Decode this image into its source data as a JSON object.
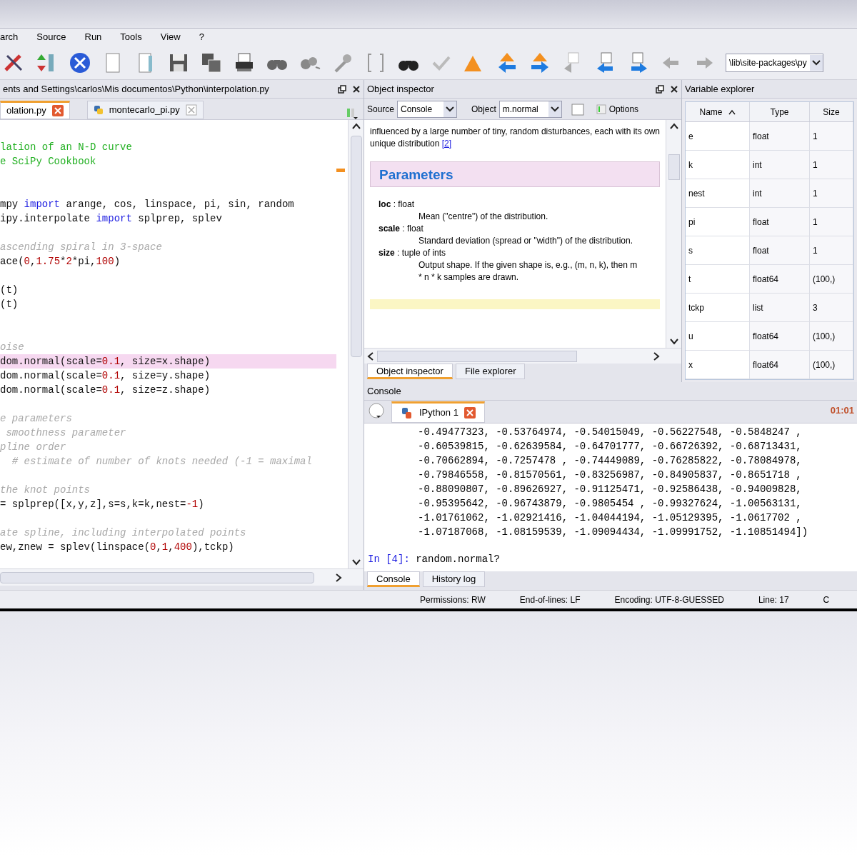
{
  "menu": [
    "arch",
    "Source",
    "Run",
    "Tools",
    "View",
    "?"
  ],
  "toolbar": {
    "path_field": "\\lib\\site-packages\\py"
  },
  "editor": {
    "title": "ents and Settings\\carlos\\Mis documentos\\Python\\interpolation.py",
    "tabs": [
      {
        "label": "olation.py",
        "selected": true
      },
      {
        "label": "montecarlo_pi.py",
        "selected": false
      }
    ],
    "lines": [
      {
        "kind": "code",
        "highlighted": false,
        "tokens": [
          {
            "kind": "docstring",
            "text": "lation of an N-D curve"
          }
        ]
      },
      {
        "kind": "code",
        "highlighted": false,
        "tokens": [
          {
            "kind": "docstring",
            "text": "e SciPy Cookbook"
          }
        ]
      },
      {
        "kind": "blank"
      },
      {
        "kind": "blank"
      },
      {
        "kind": "code",
        "highlighted": false,
        "tokens": [
          {
            "kind": "plain",
            "text": "mpy "
          },
          {
            "kind": "keyword",
            "text": "import"
          },
          {
            "kind": "plain",
            "text": " arange, cos, linspace, pi, sin, random"
          }
        ]
      },
      {
        "kind": "code",
        "highlighted": false,
        "tokens": [
          {
            "kind": "plain",
            "text": "ipy.interpolate "
          },
          {
            "kind": "keyword",
            "text": "import"
          },
          {
            "kind": "plain",
            "text": " splprep, splev"
          }
        ]
      },
      {
        "kind": "blank"
      },
      {
        "kind": "code",
        "highlighted": false,
        "tokens": [
          {
            "kind": "comment",
            "text": "ascending spiral in 3-space"
          }
        ]
      },
      {
        "kind": "code",
        "highlighted": false,
        "tokens": [
          {
            "kind": "plain",
            "text": "ace("
          },
          {
            "kind": "number",
            "text": "0"
          },
          {
            "kind": "plain",
            "text": ","
          },
          {
            "kind": "number",
            "text": "1.75"
          },
          {
            "kind": "plain",
            "text": "*"
          },
          {
            "kind": "number",
            "text": "2"
          },
          {
            "kind": "plain",
            "text": "*pi,"
          },
          {
            "kind": "number",
            "text": "100"
          },
          {
            "kind": "plain",
            "text": ")"
          }
        ]
      },
      {
        "kind": "blank"
      },
      {
        "kind": "code",
        "highlighted": false,
        "tokens": [
          {
            "kind": "plain",
            "text": "(t)"
          }
        ]
      },
      {
        "kind": "code",
        "highlighted": false,
        "tokens": [
          {
            "kind": "plain",
            "text": "(t)"
          }
        ]
      },
      {
        "kind": "blank"
      },
      {
        "kind": "blank"
      },
      {
        "kind": "code",
        "highlighted": false,
        "tokens": [
          {
            "kind": "comment",
            "text": "oise"
          }
        ]
      },
      {
        "kind": "code",
        "highlighted": true,
        "tokens": [
          {
            "kind": "plain",
            "text": "dom.normal(scale="
          },
          {
            "kind": "number",
            "text": "0.1"
          },
          {
            "kind": "plain",
            "text": ", size=x.shape)"
          }
        ]
      },
      {
        "kind": "code",
        "highlighted": false,
        "tokens": [
          {
            "kind": "plain",
            "text": "dom.normal(scale="
          },
          {
            "kind": "number",
            "text": "0.1"
          },
          {
            "kind": "plain",
            "text": ", size=y.shape)"
          }
        ]
      },
      {
        "kind": "code",
        "highlighted": false,
        "tokens": [
          {
            "kind": "plain",
            "text": "dom.normal(scale="
          },
          {
            "kind": "number",
            "text": "0.1"
          },
          {
            "kind": "plain",
            "text": ", size=z.shape)"
          }
        ]
      },
      {
        "kind": "blank"
      },
      {
        "kind": "code",
        "highlighted": false,
        "tokens": [
          {
            "kind": "comment",
            "text": "e parameters"
          }
        ]
      },
      {
        "kind": "code",
        "highlighted": false,
        "tokens": [
          {
            "kind": "comment",
            "text": " smoothness parameter"
          }
        ]
      },
      {
        "kind": "code",
        "highlighted": false,
        "tokens": [
          {
            "kind": "comment",
            "text": "pline order"
          }
        ]
      },
      {
        "kind": "code",
        "highlighted": false,
        "tokens": [
          {
            "kind": "comment",
            "text": "  # estimate of number of knots needed (-1 = maximal"
          }
        ]
      },
      {
        "kind": "blank"
      },
      {
        "kind": "code",
        "highlighted": false,
        "tokens": [
          {
            "kind": "comment",
            "text": "the knot points"
          }
        ]
      },
      {
        "kind": "code",
        "highlighted": false,
        "tokens": [
          {
            "kind": "plain",
            "text": "= splprep([x,y,z],s=s,k=k,nest="
          },
          {
            "kind": "number",
            "text": "-1"
          },
          {
            "kind": "plain",
            "text": ")"
          }
        ]
      },
      {
        "kind": "blank"
      },
      {
        "kind": "code",
        "highlighted": false,
        "tokens": [
          {
            "kind": "comment",
            "text": "ate spline, including interpolated points"
          }
        ]
      },
      {
        "kind": "code",
        "highlighted": false,
        "tokens": [
          {
            "kind": "plain",
            "text": "ew,znew = splev(linspace("
          },
          {
            "kind": "number",
            "text": "0"
          },
          {
            "kind": "plain",
            "text": ","
          },
          {
            "kind": "number",
            "text": "1"
          },
          {
            "kind": "plain",
            "text": ","
          },
          {
            "kind": "number",
            "text": "400"
          },
          {
            "kind": "plain",
            "text": "),tckp)"
          }
        ]
      }
    ]
  },
  "object_inspector": {
    "title": "Object inspector",
    "source_label": "Source",
    "source_value": "Console",
    "object_label": "Object",
    "object_value": "m.normal",
    "options": "Options",
    "intro": "influenced by a large number of tiny, random disturbances, each with its own unique distribution",
    "intro_link": "[2]",
    "section": "Parameters",
    "params": [
      {
        "name": "loc",
        "type": ": float",
        "desc": "Mean (\"centre\") of the distribution."
      },
      {
        "name": "scale",
        "type": ": float",
        "desc": "Standard deviation (spread or \"width\") of the distribution."
      },
      {
        "name": "size",
        "type": ": tuple of ints",
        "desc": "Output shape. If the given shape is, e.g., (m, n, k), then m * n * k samples are drawn."
      }
    ],
    "tabs": [
      {
        "label": "Object inspector",
        "selected": true
      },
      {
        "label": "File explorer",
        "selected": false
      }
    ]
  },
  "variable_explorer": {
    "title": "Variable explorer",
    "columns": [
      "Name",
      "Type",
      "Size"
    ],
    "rows": [
      [
        "e",
        "float",
        "1"
      ],
      [
        "k",
        "int",
        "1"
      ],
      [
        "nest",
        "int",
        "1"
      ],
      [
        "pi",
        "float",
        "1"
      ],
      [
        "s",
        "float",
        "1"
      ],
      [
        "t",
        "float64",
        "(100,)"
      ],
      [
        "tckp",
        "list",
        "3"
      ],
      [
        "u",
        "float64",
        "(100,)"
      ],
      [
        "x",
        "float64",
        "(100,)"
      ]
    ]
  },
  "console": {
    "title": "Console",
    "tab": "IPython 1",
    "elapsed": "01:01",
    "output": [
      "-0.49477323, -0.53764974, -0.54015049, -0.56227548, -0.5848247 ,",
      "-0.60539815, -0.62639584, -0.64701777, -0.66726392, -0.68713431,",
      "-0.70662894, -0.7257478 , -0.74449089, -0.76285822, -0.78084978,",
      "-0.79846558, -0.81570561, -0.83256987, -0.84905837, -0.8651718 ,",
      "-0.88090807, -0.89626927, -0.91125471, -0.92586438, -0.94009828,",
      "-0.95395642, -0.96743879, -0.9805454 , -0.99327624, -1.00563131,",
      "-1.01761062, -1.02921416, -1.04044194, -1.05129395, -1.0617702 ,",
      "-1.07187068, -1.08159539, -1.09094434, -1.09991752, -1.10851494])"
    ],
    "prompt": "In [4]:",
    "input": " random.normal?",
    "tabs": [
      {
        "label": "Console",
        "selected": true
      },
      {
        "label": "History log",
        "selected": false
      }
    ]
  },
  "status_bar": [
    "Permissions: RW",
    "End-of-lines: LF",
    "Encoding: UTF-8-GUESSED",
    "Line: 17",
    "C"
  ]
}
